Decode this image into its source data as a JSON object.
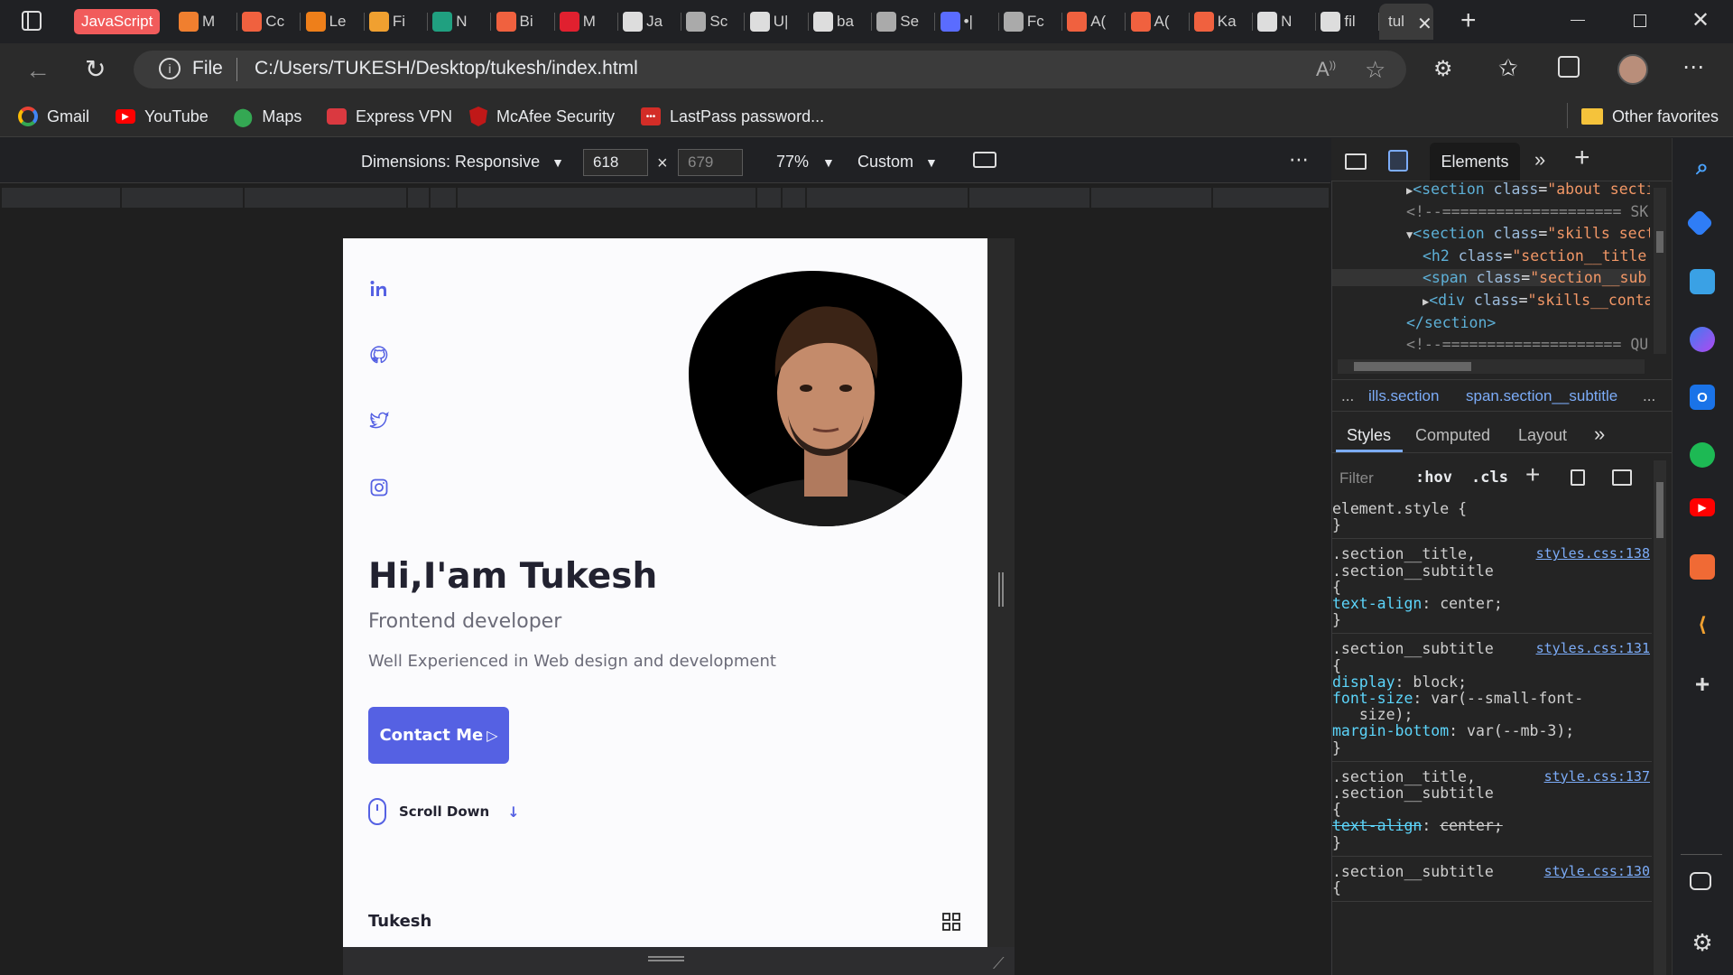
{
  "tabs": [
    {
      "label": "JavaScript",
      "active_group": true
    },
    {
      "label": "M"
    },
    {
      "label": "Cc"
    },
    {
      "label": "Le"
    },
    {
      "label": "Fi"
    },
    {
      "label": "N"
    },
    {
      "label": "Bi"
    },
    {
      "label": "M"
    },
    {
      "label": "Ja"
    },
    {
      "label": "Sc"
    },
    {
      "label": "U|"
    },
    {
      "label": "ba"
    },
    {
      "label": "Se"
    },
    {
      "label": "•|"
    },
    {
      "label": "Fc"
    },
    {
      "label": "A("
    },
    {
      "label": "A("
    },
    {
      "label": "Ka"
    },
    {
      "label": "N"
    },
    {
      "label": "fil"
    },
    {
      "label": "tul",
      "active": true
    }
  ],
  "address": {
    "scheme_label": "File",
    "url": "C:/Users/TUKESH/Desktop/tukesh/index.html"
  },
  "bookmarks": [
    {
      "label": "Gmail",
      "icon": "google-icon"
    },
    {
      "label": "YouTube",
      "icon": "youtube-icon"
    },
    {
      "label": "Maps",
      "icon": "maps-icon"
    },
    {
      "label": "Express VPN",
      "icon": "expressvpn-icon"
    },
    {
      "label": "McAfee Security",
      "icon": "mcafee-icon"
    },
    {
      "label": "LastPass password...",
      "icon": "lastpass-icon"
    }
  ],
  "other_favorites": "Other favorites",
  "device_toolbar": {
    "dimensions_label": "Dimensions: Responsive",
    "width": "618",
    "height": "679",
    "times": "×",
    "zoom": "77%",
    "throttle": "Custom"
  },
  "site": {
    "greeting": "Hi,I'am Tukesh",
    "role": "Frontend developer",
    "description": "Well Experienced in Web design and development",
    "contact_button": "Contact Me",
    "scroll_label": "Scroll Down",
    "brand": "Tukesh",
    "socials": [
      "linkedin-icon",
      "github-icon",
      "twitter-icon",
      "instagram-icon"
    ]
  },
  "devtools": {
    "panel_tab": "Elements",
    "dom_lines": [
      {
        "indent": 0,
        "open": "▶",
        "tag": "section",
        "attr": "class",
        "val": "about secti"
      },
      {
        "indent": 0,
        "comment": "<!--==================== SK"
      },
      {
        "indent": 0,
        "open": "▼",
        "tag": "section",
        "attr": "class",
        "val": "skills sect"
      },
      {
        "indent": 1,
        "tag": "h2",
        "attr": "class",
        "val": "section__title"
      },
      {
        "indent": 1,
        "tag": "span",
        "attr": "class",
        "val": "section__sub",
        "selected": true
      },
      {
        "indent": 1,
        "open": "▶",
        "tag": "div",
        "attr": "class",
        "val": "skills__conta"
      },
      {
        "indent": 0,
        "close": "</section>"
      },
      {
        "indent": 0,
        "comment": "<!--==================== QU"
      }
    ],
    "breadcrumb": [
      "...",
      "ills.section",
      "span.section__subtitle",
      "..."
    ],
    "sub_tabs": [
      "Styles",
      "Computed",
      "Layout"
    ],
    "filter_placeholder": "Filter",
    "hov": ":hov",
    "cls": ".cls",
    "rules": [
      {
        "selector": "element.style {",
        "source": "",
        "lines": [
          "}"
        ]
      },
      {
        "selector": ".section__title,",
        "selector2": ".section__subtitle",
        "source": "styles.css:138",
        "decls": [
          {
            "prop": "text-align",
            "val": "center;"
          }
        ]
      },
      {
        "selector": ".section__subtitle",
        "source": "styles.css:131",
        "decls": [
          {
            "prop": "display",
            "val": "block;"
          },
          {
            "prop": "font-size",
            "val": "var(--small-font-"
          },
          {
            "prop": "",
            "val": "size);"
          },
          {
            "prop": "margin-bottom",
            "val": "var(--mb-3);"
          }
        ]
      },
      {
        "selector": ".section__title,",
        "selector2": ".section__subtitle",
        "source": "style.css:137",
        "decls": [
          {
            "prop": "text-align",
            "val": "center;",
            "struck": true
          }
        ]
      },
      {
        "selector": ".section__subtitle",
        "source": "style.css:130",
        "decls": []
      }
    ]
  },
  "colors": {
    "accent": "#5561e3",
    "page_bg": "#fbfbfd",
    "chrome_bg": "#202124",
    "active_tab_group": "#f15b5b"
  }
}
